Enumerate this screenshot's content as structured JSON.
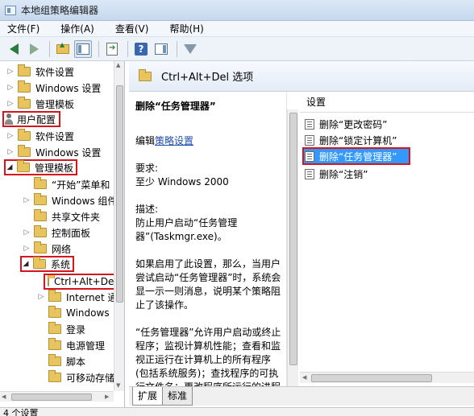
{
  "window": {
    "title": "本地组策略编辑器"
  },
  "menu": [
    "文件(F)",
    "操作(A)",
    "查看(V)",
    "帮助(H)"
  ],
  "toolbar": {
    "icons": [
      "back-arrow-icon",
      "forward-arrow-icon",
      "folder-up-icon",
      "show-hide-console-tree-icon",
      "export-list-icon",
      "help-icon",
      "properties-icon",
      "filter-icon"
    ]
  },
  "tree": {
    "items": [
      {
        "label": "软件设置",
        "twisty": "▷"
      },
      {
        "label": "Windows 设置",
        "twisty": "▷"
      },
      {
        "label": "管理模板",
        "twisty": "▷"
      },
      {
        "label": "用户配置",
        "twisty": ""
      },
      {
        "label": "软件设置",
        "twisty": "▷"
      },
      {
        "label": "Windows 设置",
        "twisty": "▷"
      },
      {
        "label": "管理模板",
        "twisty": "◢"
      },
      {
        "label": "“开始”菜单和",
        "twisty": ""
      },
      {
        "label": "Windows 组件",
        "twisty": "▷"
      },
      {
        "label": "共享文件夹",
        "twisty": ""
      },
      {
        "label": "控制面板",
        "twisty": "▷"
      },
      {
        "label": "网络",
        "twisty": "▷"
      },
      {
        "label": "系统",
        "twisty": "◢"
      },
      {
        "label": "Ctrl+Alt+Del",
        "twisty": ""
      },
      {
        "label": "Internet 通",
        "twisty": "▷"
      },
      {
        "label": "Windows",
        "twisty": ""
      },
      {
        "label": "登录",
        "twisty": ""
      },
      {
        "label": "电源管理",
        "twisty": ""
      },
      {
        "label": "脚本",
        "twisty": ""
      },
      {
        "label": "可移动存储",
        "twisty": ""
      }
    ]
  },
  "right_header": {
    "title": "Ctrl+Alt+Del 选项"
  },
  "description": {
    "heading": "删除“任务管理器”",
    "edit_prefix": "编辑",
    "edit_link": "策略设置",
    "req_label": "要求:",
    "req_value": "至少 Windows 2000",
    "desc_label": "描述:",
    "desc_value": "防止用户启动“任务管理器”(Taskmgr.exe)。",
    "para1": "如果启用了此设置，那么，当用户尝试启动“任务管理器”时，系统会显一示一则消息，说明某个策略阻止了该操作。",
    "para2": "“任务管理器”允许用户启动或终止程序；监视计算机性能；查看和监视正运行在计算机上的所有程序(包括系统服务)；查找程序的可执行文件名；更改程序所运行的进程"
  },
  "settings": {
    "header": "设置",
    "items": [
      "删除“更改密码”",
      "删除“锁定计算机”",
      "删除“任务管理器”",
      "删除“注销”"
    ],
    "selected_index": 2
  },
  "tabs": [
    "扩展",
    "标准"
  ],
  "status": {
    "text": "4 个设置"
  },
  "colors": {
    "selection": "#3399ff",
    "annotation_red": "#d6141e",
    "link": "#1d4fa8"
  }
}
